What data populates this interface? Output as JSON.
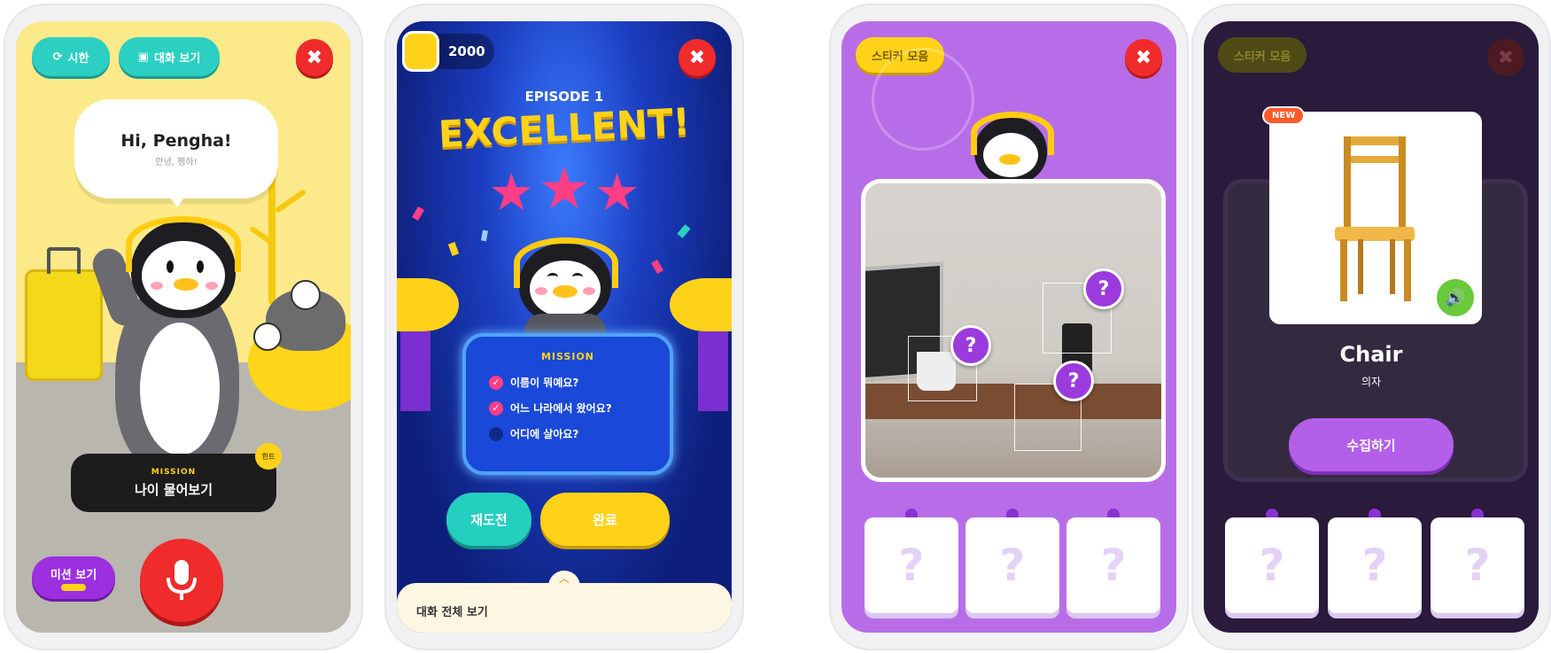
{
  "screen1": {
    "translate_label": "시한",
    "view_conversation_label": "대화 보기",
    "speech_main": "Hi, Pengha!",
    "speech_sub": "안녕, 펭하!",
    "mission_title": "MISSION",
    "mission_text": "나이 물어보기",
    "mission_view_label": "미션 보기",
    "hint_label": "힌트",
    "colors": {
      "bg": "#fbe98a",
      "floor": "#b9b6ae",
      "accent": "#2bd0c3",
      "mic": "#ef2b2b"
    }
  },
  "screen2": {
    "coins": "2000",
    "episode": "EPISODE 1",
    "headline": "EXCELLENT!",
    "stars": 3,
    "mission_title": "MISSION",
    "missions": [
      {
        "text": "이름이 뭐예요?",
        "done": true
      },
      {
        "text": "어느 나라에서 왔어요?",
        "done": true
      },
      {
        "text": "어디에 살아요?",
        "done": false
      }
    ],
    "retry_label": "재도전",
    "finish_label": "완료",
    "full_conversation_label": "대화 전체 보기",
    "colors": {
      "bg": "#0d1f7a",
      "panel": "#1a49d9",
      "retry": "#24cfc0",
      "finish": "#ffd21a"
    }
  },
  "screen3": {
    "sticker_label": "스티커 모음",
    "hotspot_symbol": "?",
    "slot_symbol": "?",
    "colors": {
      "bg": "#b86de8",
      "frame": "#ffffff"
    }
  },
  "screen4": {
    "sticker_label": "스티커 모음",
    "new_badge": "NEW",
    "word": "Chair",
    "word_translation": "의자",
    "collect_label": "수집하기",
    "slot_symbol": "?",
    "colors": {
      "bg": "#2a1a3c",
      "collect": "#b35fea",
      "sound": "#6ac93a"
    }
  }
}
